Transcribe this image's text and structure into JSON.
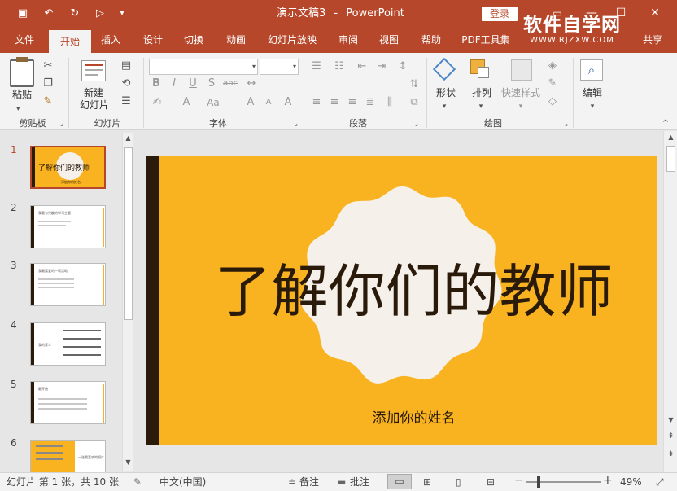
{
  "window": {
    "doc_name": "演示文稿3",
    "separator": "-",
    "app_name": "PowerPoint",
    "login_label": "登录",
    "watermark_text": "软件自学网",
    "watermark_url": "WWW.RJZXW.COM"
  },
  "tabs": [
    {
      "label": "文件"
    },
    {
      "label": "开始"
    },
    {
      "label": "插入"
    },
    {
      "label": "设计"
    },
    {
      "label": "切换"
    },
    {
      "label": "动画"
    },
    {
      "label": "幻灯片放映"
    },
    {
      "label": "审阅"
    },
    {
      "label": "视图"
    },
    {
      "label": "帮助"
    },
    {
      "label": "PDF工具集"
    },
    {
      "label": "共享"
    }
  ],
  "ribbon": {
    "paste_label": "粘贴",
    "new_slide_label": "新建",
    "new_slide_label2": "幻灯片",
    "shapes_label": "形状",
    "arrange_label": "排列",
    "quick_styles_label": "快速样式",
    "editing_label": "编辑",
    "groups": {
      "clipboard": "剪贴板",
      "slides": "幻灯片",
      "font": "字体",
      "paragraph": "段落",
      "drawing": "绘图"
    },
    "font_buttons": {
      "bold": "B",
      "italic": "I",
      "underline": "U",
      "shadow": "S",
      "strike": "abc",
      "grow": "A",
      "change_case": "Aa",
      "clear": "A",
      "color": "A"
    }
  },
  "thumbnails": [
    {
      "num": "1",
      "title": "了解你们的教师",
      "sub": "添加你的姓名"
    },
    {
      "num": "2",
      "title": "我最有兴趣的学习主题"
    },
    {
      "num": "3",
      "title": "我最喜爱的一项活动"
    },
    {
      "num": "4",
      "title": "我的家人"
    },
    {
      "num": "5",
      "title": "最开始"
    },
    {
      "num": "6",
      "title": "一张我喜欢的照片"
    }
  ],
  "slide": {
    "title": "了解你们的教师",
    "subtitle": "添加你的姓名"
  },
  "status": {
    "slide_info": "幻灯片 第 1 张，共 10 张",
    "language": "中文(中国)",
    "notes_label": "备注",
    "comments_label": "批注",
    "zoom_level": "49%",
    "zoom_minus": "−",
    "zoom_plus": "+"
  },
  "colors": {
    "accent": "#b7472a",
    "slide_bg": "#f9b321",
    "slide_dark": "#2a1a0a"
  }
}
